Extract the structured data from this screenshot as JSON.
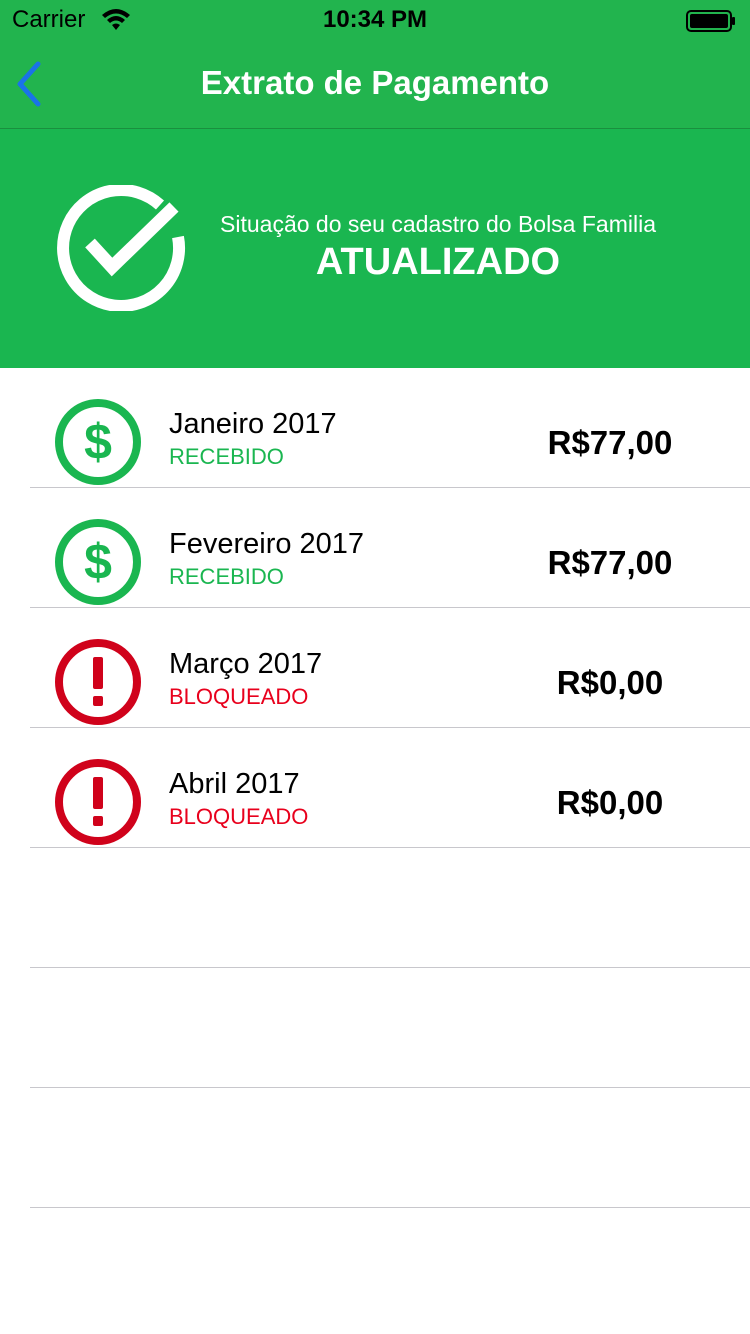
{
  "status_bar": {
    "carrier": "Carrier",
    "time": "10:34 PM",
    "wifi_icon": "wifi-icon",
    "battery_icon": "battery-icon"
  },
  "nav": {
    "title": "Extrato de Pagamento",
    "back_icon": "chevron-left-icon",
    "accent_color": "#1a73e8"
  },
  "banner": {
    "icon": "check-circle-icon",
    "subtitle": "Situação do seu cadastro do Bolsa Familia",
    "status": "ATUALIZADO",
    "background": "#1ab650"
  },
  "payments": [
    {
      "month": "Janeiro 2017",
      "status": "RECEBIDO",
      "amount": "R$77,00",
      "icon": "dollar-circle-icon",
      "status_color": "#1ab650"
    },
    {
      "month": "Fevereiro 2017",
      "status": "RECEBIDO",
      "amount": "R$77,00",
      "icon": "dollar-circle-icon",
      "status_color": "#1ab650"
    },
    {
      "month": "Março 2017",
      "status": "BLOQUEADO",
      "amount": "R$0,00",
      "icon": "exclamation-circle-icon",
      "status_color": "#d0021b"
    },
    {
      "month": "Abril 2017",
      "status": "BLOQUEADO",
      "amount": "R$0,00",
      "icon": "exclamation-circle-icon",
      "status_color": "#d0021b"
    }
  ]
}
